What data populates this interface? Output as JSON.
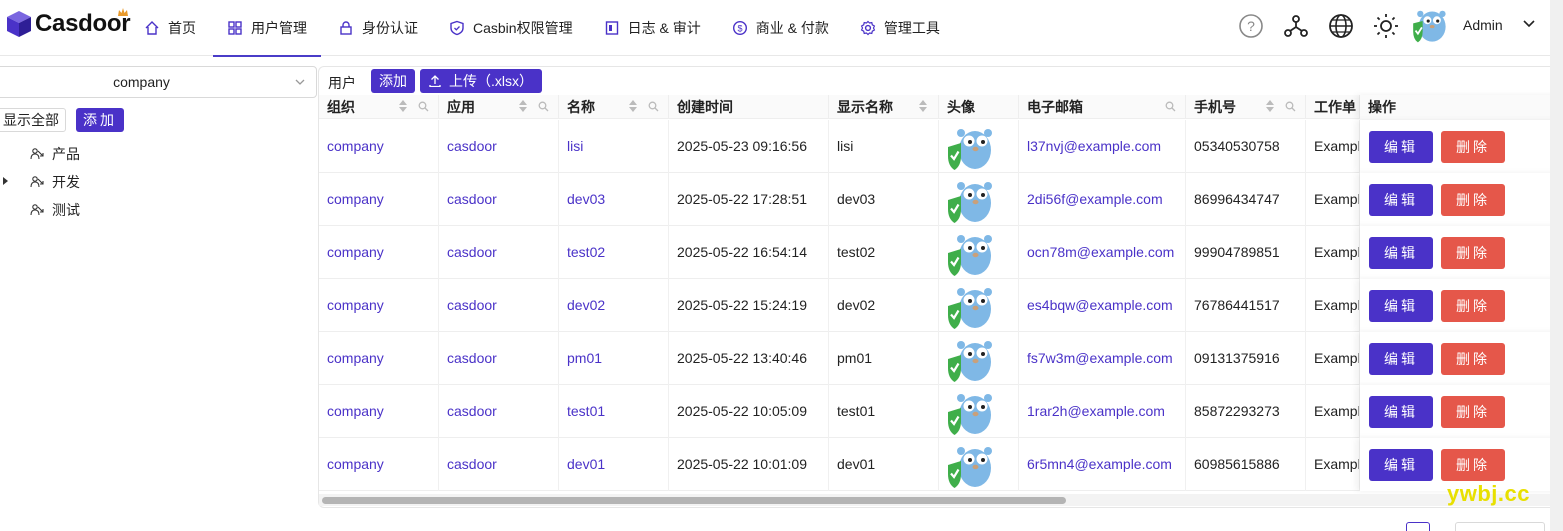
{
  "app": {
    "name": "Casdoor"
  },
  "nav": [
    {
      "label": "首页",
      "icon": "home-icon"
    },
    {
      "label": "用户管理",
      "icon": "appstore-icon",
      "active": true
    },
    {
      "label": "身份认证",
      "icon": "lock-icon"
    },
    {
      "label": "Casbin权限管理",
      "icon": "shield-icon"
    },
    {
      "label": "日志 & 审计",
      "icon": "log-icon"
    },
    {
      "label": "商业 & 付款",
      "icon": "dollar-icon"
    },
    {
      "label": "管理工具",
      "icon": "settings-icon"
    }
  ],
  "header": {
    "user_name": "Admin"
  },
  "left": {
    "org_select_value": "company",
    "show_all_label": "显示全部",
    "add_label": "添加",
    "tree": [
      {
        "label": "产品",
        "expandable": false
      },
      {
        "label": "开发",
        "expandable": true
      },
      {
        "label": "测试",
        "expandable": false
      }
    ]
  },
  "toolbar": {
    "title": "用户",
    "add_label": "添加",
    "upload_label": "上传（.xlsx）"
  },
  "table": {
    "columns": [
      "组织",
      "应用",
      "名称",
      "创建时间",
      "显示名称",
      "头像",
      "电子邮箱",
      "手机号",
      "工作单位",
      "操作"
    ],
    "edit_label": "编辑",
    "delete_label": "删除",
    "rows": [
      {
        "org": "company",
        "app": "casdoor",
        "name": "lisi",
        "created": "2025-05-23 09:16:56",
        "display": "lisi",
        "email": "l37nvj@example.com",
        "phone": "05340530758",
        "affiliation": "Example Inc."
      },
      {
        "org": "company",
        "app": "casdoor",
        "name": "dev03",
        "created": "2025-05-22 17:28:51",
        "display": "dev03",
        "email": "2di56f@example.com",
        "phone": "86996434747",
        "affiliation": "Example Inc."
      },
      {
        "org": "company",
        "app": "casdoor",
        "name": "test02",
        "created": "2025-05-22 16:54:14",
        "display": "test02",
        "email": "ocn78m@example.com",
        "phone": "99904789851",
        "affiliation": "Example Inc."
      },
      {
        "org": "company",
        "app": "casdoor",
        "name": "dev02",
        "created": "2025-05-22 15:24:19",
        "display": "dev02",
        "email": "es4bqw@example.com",
        "phone": "76786441517",
        "affiliation": "Example Inc."
      },
      {
        "org": "company",
        "app": "casdoor",
        "name": "pm01",
        "created": "2025-05-22 13:40:46",
        "display": "pm01",
        "email": "fs7w3m@example.com",
        "phone": "09131375916",
        "affiliation": "Example Inc."
      },
      {
        "org": "company",
        "app": "casdoor",
        "name": "test01",
        "created": "2025-05-22 10:05:09",
        "display": "test01",
        "email": "1rar2h@example.com",
        "phone": "85872293273",
        "affiliation": "Example Inc."
      },
      {
        "org": "company",
        "app": "casdoor",
        "name": "dev01",
        "created": "2025-05-22 10:01:09",
        "display": "dev01",
        "email": "6r5mn4@example.com",
        "phone": "60985615886",
        "affiliation": "Example Inc."
      }
    ]
  },
  "watermark": "ywbj.cc",
  "colors": {
    "primary": "#4a32c8",
    "danger": "#e5574a",
    "watermark": "#e8e000"
  }
}
